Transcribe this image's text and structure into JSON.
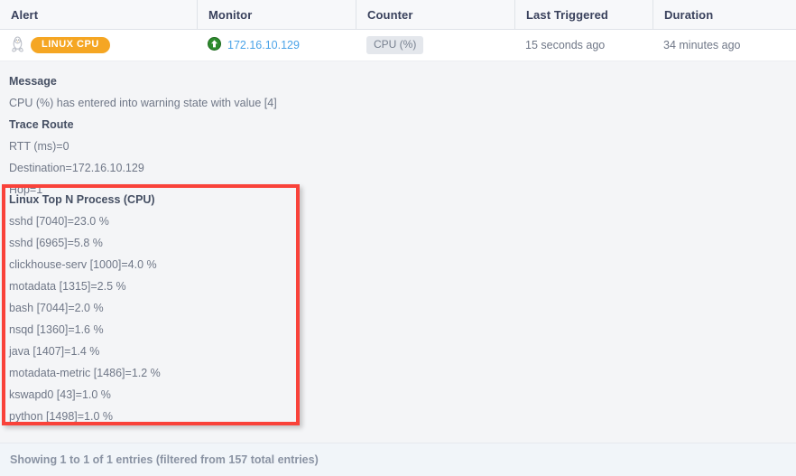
{
  "table": {
    "columns": [
      {
        "key": "alert",
        "label": "Alert"
      },
      {
        "key": "monitor",
        "label": "Monitor"
      },
      {
        "key": "counter",
        "label": "Counter"
      },
      {
        "key": "last_triggered",
        "label": "Last Triggered"
      },
      {
        "key": "duration",
        "label": "Duration"
      }
    ],
    "row": {
      "alert_icon": "linux-tux-icon",
      "alert_badge": "LINUX CPU",
      "alert_badge_color": "#f5a623",
      "monitor_status_icon": "status-up-arrow-icon",
      "monitor_status_color": "#2e7d32",
      "monitor_ip": "172.16.10.129",
      "monitor_link_color": "#4aa3e8",
      "counter": "CPU (%)",
      "last_triggered": "15 seconds ago",
      "duration": "34 minutes ago"
    }
  },
  "detail": {
    "message_label": "Message",
    "message_value": "CPU (%) has entered into warning state with value [4]",
    "trace_route_label": "Trace Route",
    "trace_route_lines": [
      "RTT (ms)=0",
      "Destination=172.16.10.129",
      "Hop=1"
    ]
  },
  "highlight": {
    "border_color": "#f9423a",
    "title": "Linux Top N Process (CPU)",
    "processes": [
      "sshd [7040]=23.0 %",
      "sshd [6965]=5.8 %",
      "clickhouse-serv [1000]=4.0 %",
      "motadata [1315]=2.5 %",
      "bash [7044]=2.0 %",
      "nsqd [1360]=1.6 %",
      "java [1407]=1.4 %",
      "motadata-metric [1486]=1.2 %",
      "kswapd0 [43]=1.0 %",
      "python [1498]=1.0 %"
    ]
  },
  "footer": {
    "status": "Showing 1 to 1 of 1 entries (filtered from 157 total entries)"
  }
}
